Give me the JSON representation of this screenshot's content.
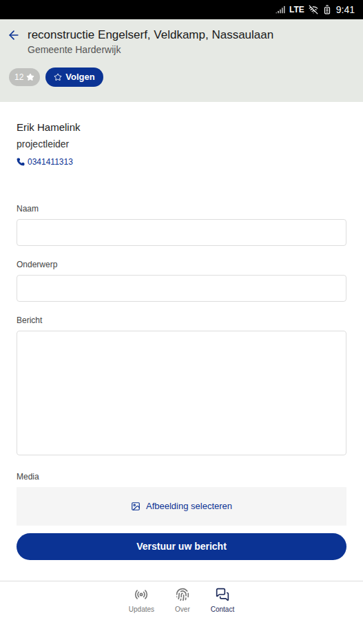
{
  "status_bar": {
    "network": "LTE",
    "time": "9:41"
  },
  "header": {
    "title": "reconstructie Engelserf, Veldkamp, Nassaulaan",
    "subtitle": "Gemeente Harderwijk",
    "followers": "12",
    "follow_button": "Volgen"
  },
  "contact": {
    "name": "Erik Hamelink",
    "role": "projectleider",
    "phone": "0341411313"
  },
  "form": {
    "fields": [
      {
        "label": "Naam",
        "kind": "input",
        "value": ""
      },
      {
        "label": "Onderwerp",
        "kind": "input",
        "value": ""
      },
      {
        "label": "Bericht",
        "kind": "textarea",
        "value": ""
      }
    ],
    "media": {
      "label": "Media",
      "button": "Afbeelding selecteren"
    },
    "submit": "Verstuur uw bericht"
  },
  "nav": [
    {
      "label": "Updates",
      "selected": false
    },
    {
      "label": "Over",
      "selected": false
    },
    {
      "label": "Contact",
      "selected": true
    }
  ]
}
